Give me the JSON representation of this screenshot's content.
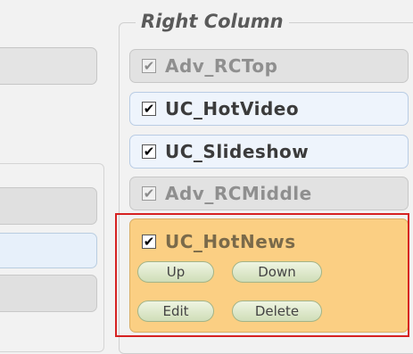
{
  "right_column": {
    "legend": "Right Column",
    "items": [
      {
        "label": "Adv_RCTop",
        "checked": true,
        "locked": true
      },
      {
        "label": "UC_HotVideo",
        "checked": true,
        "locked": false
      },
      {
        "label": "UC_Slideshow",
        "checked": true,
        "locked": false
      },
      {
        "label": "Adv_RCMiddle",
        "checked": true,
        "locked": true
      }
    ],
    "selected_item": {
      "label": "UC_HotNews",
      "checked": true,
      "buttons": {
        "up": "Up",
        "down": "Down",
        "edit": "Edit",
        "delete": "Delete"
      }
    }
  },
  "check_glyph": "✔",
  "colors": {
    "selection_border": "#d62222",
    "selected_item_bg": "#fbcf83",
    "button_border": "#a3b487"
  }
}
